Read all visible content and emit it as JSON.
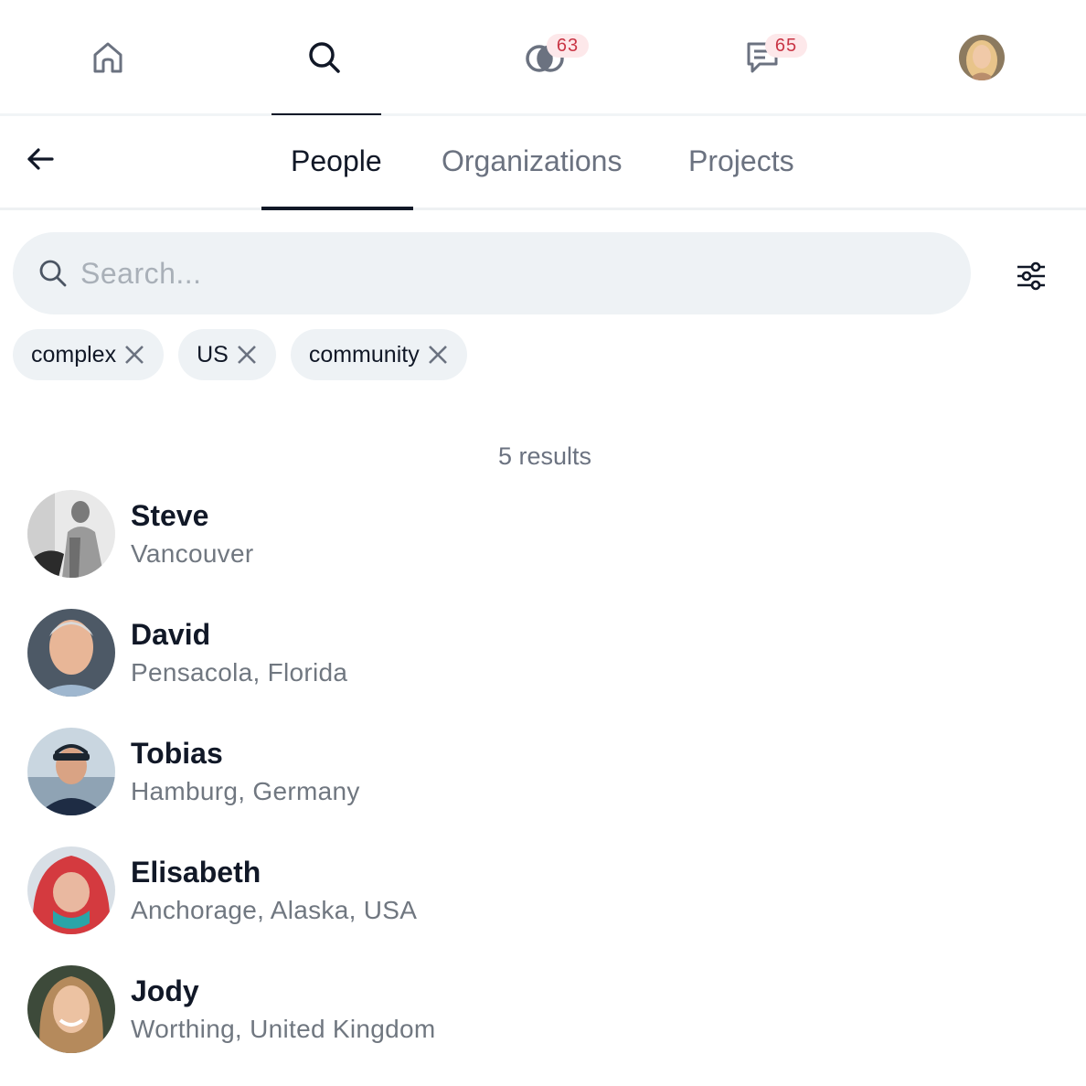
{
  "nav": {
    "items": [
      {
        "name": "home",
        "icon": "home-icon"
      },
      {
        "name": "search",
        "icon": "search-icon",
        "active": true
      },
      {
        "name": "circles",
        "icon": "overlapping-circles-icon",
        "badge": "63"
      },
      {
        "name": "messages",
        "icon": "chat-icon",
        "badge": "65"
      },
      {
        "name": "profile",
        "icon": "avatar"
      }
    ],
    "badge_color": "#c93545",
    "badge_bg": "#fde8ea"
  },
  "tabs": {
    "items": [
      {
        "label": "People",
        "active": true
      },
      {
        "label": "Organizations"
      },
      {
        "label": "Projects"
      }
    ]
  },
  "search": {
    "placeholder": "Search...",
    "value": ""
  },
  "filters": {
    "chips": [
      {
        "label": "complex"
      },
      {
        "label": "US"
      },
      {
        "label": "community"
      }
    ]
  },
  "results": {
    "count_text": "5 results",
    "items": [
      {
        "name": "Steve",
        "location": "Vancouver"
      },
      {
        "name": "David",
        "location": "Pensacola, Florida"
      },
      {
        "name": "Tobias",
        "location": "Hamburg, Germany"
      },
      {
        "name": "Elisabeth",
        "location": "Anchorage, Alaska, USA"
      },
      {
        "name": "Jody",
        "location": "Worthing, United Kingdom"
      }
    ]
  },
  "colors": {
    "text": "#111827",
    "muted": "#6b7280",
    "surface": "#eef2f5"
  }
}
